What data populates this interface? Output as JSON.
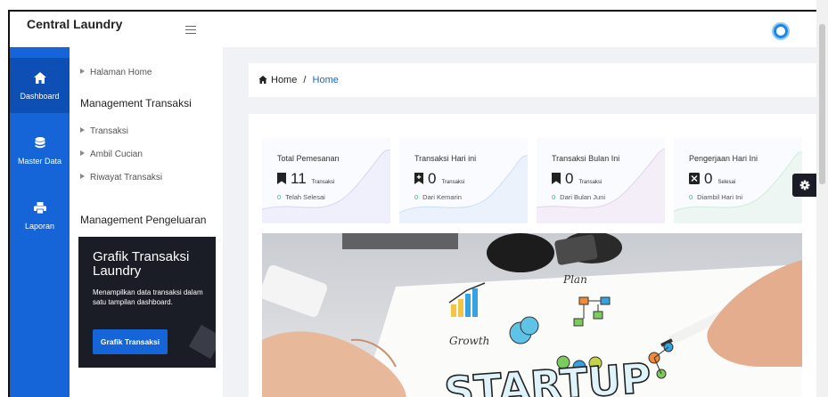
{
  "app": {
    "brand": "Central Laundry"
  },
  "nav": [
    {
      "label": "Dashboard",
      "icon": "home-icon"
    },
    {
      "label": "Master Data",
      "icon": "database-icon"
    },
    {
      "label": "Laporan",
      "icon": "printer-icon"
    }
  ],
  "submenu": {
    "home_link": "Halaman Home",
    "section1": "Management Transaksi",
    "links": [
      "Transaksi",
      "Ambil Cucian",
      "Riwayat Transaksi"
    ],
    "section2": "Management Pengeluaran"
  },
  "promo": {
    "title": "Grafik Transaksi Laundry",
    "text": "Menampilkan data transaksi dalam satu tampilan dashboard.",
    "button": "Grafik Transaksi"
  },
  "breadcrumb": {
    "root": "Home",
    "separator": "/",
    "current": "Home"
  },
  "stats": [
    {
      "title": "Total Pemesanan",
      "value": "11",
      "unit": "Transaksi",
      "foot_num": "0",
      "foot_text": "Telah Selesai",
      "wave_color": "#d9dcf5"
    },
    {
      "title": "Transaksi Hari ini",
      "value": "0",
      "unit": "Transaksi",
      "foot_num": "0",
      "foot_text": "Dari Kemarin",
      "wave_color": "#cfe3f7"
    },
    {
      "title": "Transaksi Bulan Ini",
      "value": "0",
      "unit": "Transaksi",
      "foot_num": "0",
      "foot_text": "Dari Bulan Juni",
      "wave_color": "#e8d6ee"
    },
    {
      "title": "Pengerjaan Hari Ini",
      "value": "0",
      "unit": "Selesai",
      "foot_num": "0",
      "foot_text": "Diambil Hari Ini",
      "wave_color": "#d6eedc"
    }
  ],
  "hero": {
    "words": [
      "Growth",
      "Plan",
      "STARTUP"
    ]
  },
  "colors": {
    "primary": "#1565d8",
    "sidebar_dark": "#0d4fb5",
    "promo_bg": "#1b1d26",
    "success": "#2bb673"
  }
}
